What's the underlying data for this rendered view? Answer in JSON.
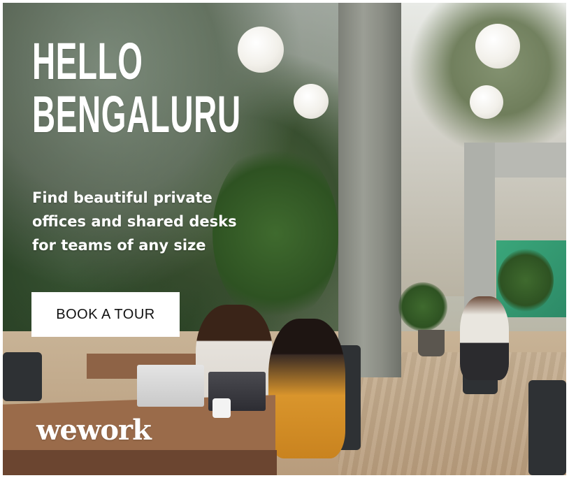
{
  "headline": {
    "line1": "HELLO",
    "line2": "BENGALURU"
  },
  "subtext": {
    "line1": "Find beautiful private",
    "line2": "offices and shared desks",
    "line3": "for teams of any size"
  },
  "cta": {
    "label": "BOOK A TOUR"
  },
  "brand": {
    "logo_text": "wework"
  },
  "colors": {
    "text": "#ffffff",
    "button_background": "#ffffff",
    "button_text": "#111111"
  }
}
